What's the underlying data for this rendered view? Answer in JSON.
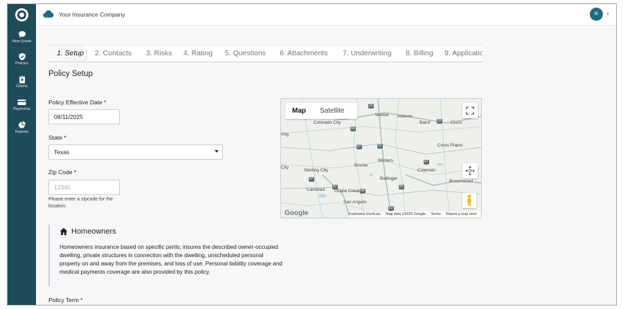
{
  "app": {
    "company_name": "Your Insurance Company",
    "user_initial": "R"
  },
  "sidebar": {
    "items": [
      {
        "label": "New Quote",
        "icon": "chat-bubble-icon"
      },
      {
        "label": "Policies",
        "icon": "shield-check-icon"
      },
      {
        "label": "Claims",
        "icon": "clipboard-plus-icon"
      },
      {
        "label": "Payments",
        "icon": "credit-card-icon"
      },
      {
        "label": "Reports",
        "icon": "pie-chart-icon"
      }
    ]
  },
  "tabs": [
    {
      "label": "1. Setup",
      "active": true
    },
    {
      "label": "2. Contacts"
    },
    {
      "label": "3. Risks"
    },
    {
      "label": "4. Rating"
    },
    {
      "label": "5. Questions"
    },
    {
      "label": "6. Attachments"
    },
    {
      "label": "7. Underwriting"
    },
    {
      "label": "8. Billing"
    },
    {
      "label": "9. Applicatio"
    }
  ],
  "form": {
    "title": "Policy Setup",
    "effective_date_label": "Policy Effective Date",
    "effective_date_value": "08/11/2025",
    "state_label": "State",
    "state_value": "Texas",
    "zip_label": "Zip Code",
    "zip_placeholder": "12345",
    "zip_help": "Please enter a zipcode for the location.",
    "required_mark": "*",
    "policy_term_label": "Policy Term"
  },
  "map": {
    "type_map": "Map",
    "type_satellite": "Satellite",
    "cities": [
      "Merkel",
      "Abilene",
      "Colorado City",
      "Baird",
      "Cisco",
      "Cross Plains",
      "Winters",
      "Bronte",
      "Sterling City",
      "Coleman",
      "Ballinger",
      "Brownwood",
      "Carlsbad",
      "Grape Creek",
      "San Angelo"
    ],
    "highways": [
      "20",
      "20",
      "84",
      "83",
      "87",
      "67",
      "87",
      "87",
      "83",
      "84",
      "83"
    ],
    "footer": {
      "shortcuts": "Keyboard shortcuts",
      "data": "Map data ©2025 Google",
      "terms": "Terms",
      "report": "Report a map error"
    },
    "google": "Google",
    "partial_labels": [
      "ring",
      "City"
    ]
  },
  "homeowners": {
    "title": "Homeowners",
    "description": "Homeowners insurance based on specific perils; insures the described owner-occupied dwelling, private structures in connection with the dwelling, unscheduled personal property on and away from the premises, and loss of use. Personal liability coverage and medical payments coverage are also provided by this policy."
  },
  "colors": {
    "sidebar": "#1f4b5a",
    "accent": "#1f6b80"
  }
}
